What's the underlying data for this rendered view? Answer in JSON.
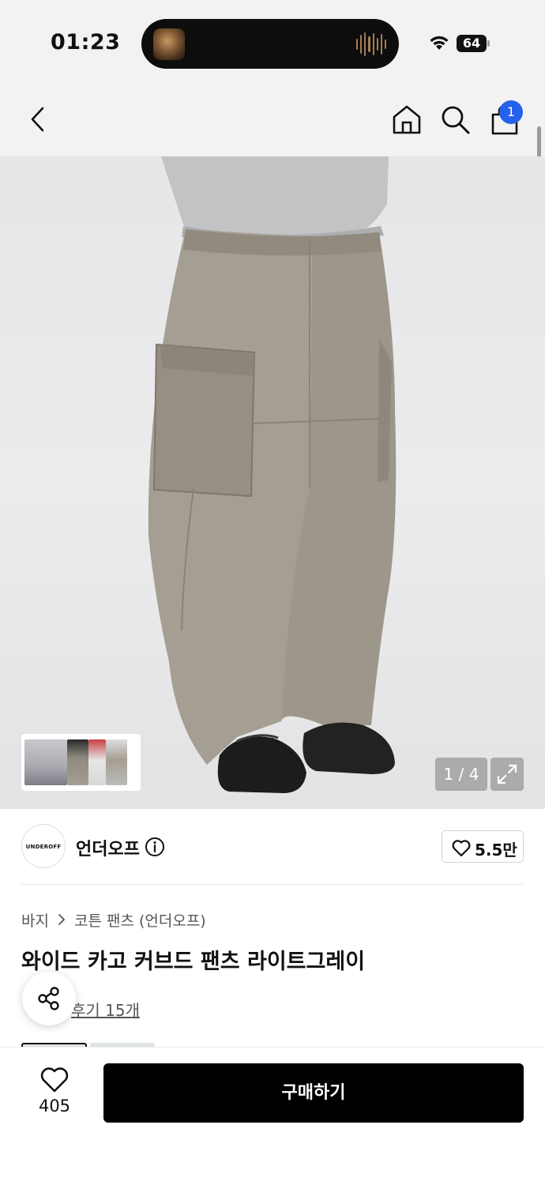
{
  "status_bar": {
    "time": "01:23",
    "battery": "64"
  },
  "header": {
    "cart_badge": "1"
  },
  "gallery": {
    "counter": "1 / 4"
  },
  "brand": {
    "logo_text": "UNDEROFF",
    "name": "언더오프",
    "like_count": "5.5만"
  },
  "product": {
    "breadcrumb": [
      "바지",
      "코튼 팬츠 (언더오프)"
    ],
    "title": "와이드 카고 커브드 팬츠 라이트그레이",
    "review_text": "후기 15개"
  },
  "bottom_bar": {
    "wish_count": "405",
    "buy_label": "구매하기"
  },
  "colors": {
    "accent_badge": "#2462ee",
    "buy_button": "#000000",
    "pants": "#a59e92"
  },
  "icons": [
    "back-icon",
    "home-icon",
    "search-icon",
    "cart-icon",
    "expand-icon",
    "info-icon",
    "heart-icon",
    "share-icon",
    "wifi-icon",
    "chevron-right-icon"
  ]
}
